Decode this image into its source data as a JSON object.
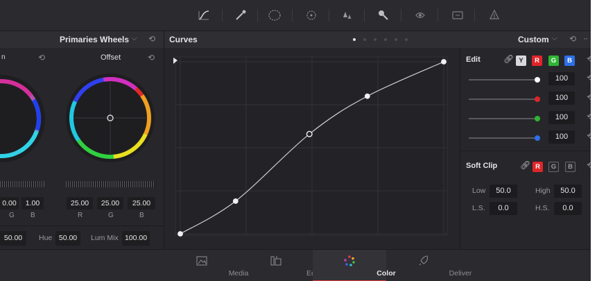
{
  "toolbar": {
    "icons": [
      "curves-icon",
      "eyedropper-icon",
      "window-icon",
      "tracker-icon",
      "blur-icon",
      "key-icon",
      "sizing-icon",
      "info-icon",
      "3d-icon"
    ]
  },
  "primaries": {
    "mode_label": "Primaries Wheels",
    "offset_title": "Offset",
    "left_values": [
      "0.00",
      "1.00"
    ],
    "left_channels": [
      "G",
      "B"
    ],
    "offset_values": [
      "25.00",
      "25.00",
      "25.00"
    ],
    "offset_channels": [
      "R",
      "G",
      "B"
    ],
    "bottom": {
      "first_value": "50.00",
      "hue_label": "Hue",
      "hue_value": "50.00",
      "lummix_label": "Lum Mix",
      "lummix_value": "100.00"
    }
  },
  "curves": {
    "title": "Curves",
    "mode_label": "Custom",
    "points": [
      [
        0,
        0
      ],
      [
        0.21,
        0.19
      ],
      [
        0.49,
        0.58
      ],
      [
        0.71,
        0.8
      ],
      [
        1,
        1
      ]
    ]
  },
  "edit": {
    "title": "Edit",
    "channels": [
      "Y",
      "R",
      "G",
      "B"
    ],
    "sliders": [
      {
        "value": "100",
        "color": "#ffffff"
      },
      {
        "value": "100",
        "color": "#e0252a"
      },
      {
        "value": "100",
        "color": "#2fb533"
      },
      {
        "value": "100",
        "color": "#2d6fe8"
      }
    ]
  },
  "softclip": {
    "title": "Soft Clip",
    "channels": [
      "R",
      "G",
      "B"
    ],
    "low_label": "Low",
    "low_value": "50.0",
    "high_label": "High",
    "high_value": "50.0",
    "ls_label": "L.S.",
    "ls_value": "0.0",
    "hs_label": "H.S.",
    "hs_value": "0.0"
  },
  "pages": [
    {
      "label": "Media",
      "active": false
    },
    {
      "label": "Edit",
      "active": false
    },
    {
      "label": "Color",
      "active": true
    },
    {
      "label": "Deliver",
      "active": false
    }
  ],
  "colors": {
    "accent_red": "#e0252a",
    "accent_green": "#2fb533",
    "accent_blue": "#2d6fe8",
    "active_tab_underline": "#e03a3a"
  }
}
